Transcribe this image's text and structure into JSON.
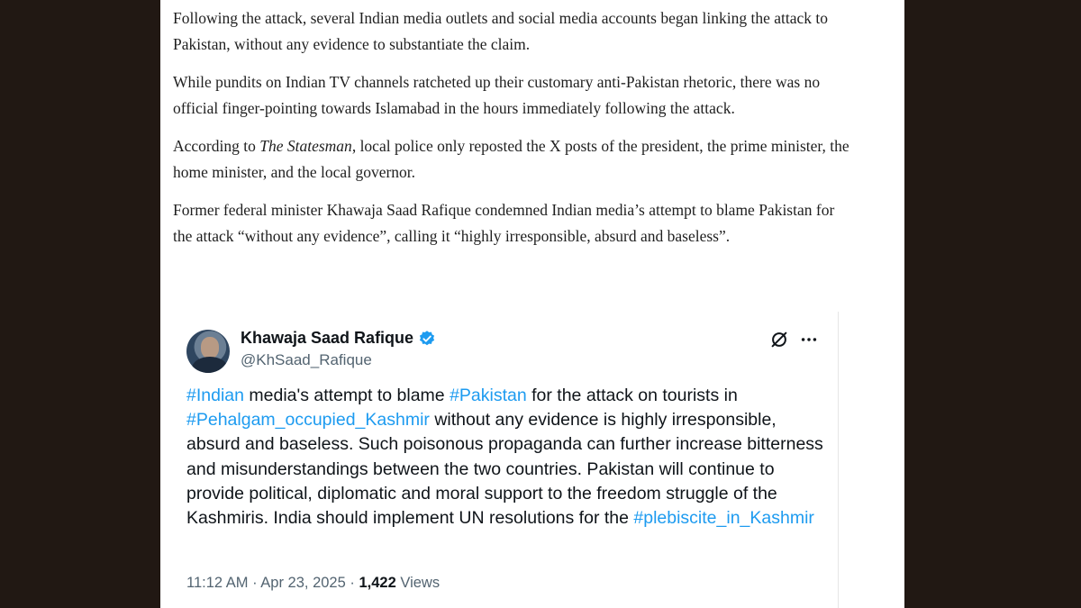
{
  "article": {
    "p1": "Following the attack, several Indian media outlets and social media accounts began linking the attack to Pakistan, without any evidence to substantiate the claim.",
    "p2": "While pundits on Indian TV channels ratcheted up their customary anti-Pakistan rhetoric, there was no official finger-pointing towards Islamabad in the hours immediately following the attack.",
    "p3_before": "According to ",
    "p3_source": "The Statesman",
    "p3_after": ", local police only reposted the X posts of the president, the prime minister, the home minister, and the local governor.",
    "p4": "Former federal minister Khawaja Saad Rafique condemned Indian media’s attempt to blame Pakistan for the attack “without any evidence”, calling it “highly irresponsible, absurd and baseless”."
  },
  "tweet": {
    "display_name": "Khawaja Saad Rafique",
    "handle": "@KhSaad_Rafique",
    "verified": true,
    "icons": {
      "verified": "verified-badge-icon",
      "grok": "grok-icon",
      "more": "more-options-icon"
    },
    "text_segments": {
      "s1": "#Indian",
      "s2": " media's attempt to blame ",
      "s3": "#Pakistan",
      "s4": " for the attack on tourists in ",
      "s5": "#Pehalgam_occupied_Kashmir",
      "s6": " without any evidence is highly irresponsible, absurd and baseless. Such poisonous propaganda can further increase bitterness and misunderstandings between the two countries. Pakistan will continue to provide political, diplomatic and moral support to the freedom struggle of the Kashmiris. India should implement UN resolutions for the ",
      "s7": "#plebiscite_in_Kashmir"
    },
    "time": "11:12 AM",
    "separator": "·",
    "date": "Apr 23, 2025",
    "views_count": "1,422",
    "views_label": "Views"
  },
  "colors": {
    "background": "#211813",
    "page": "#ffffff",
    "hashtag": "#1d9bf0",
    "secondary_text": "#536471",
    "verified_badge": "#1d9bf0"
  }
}
